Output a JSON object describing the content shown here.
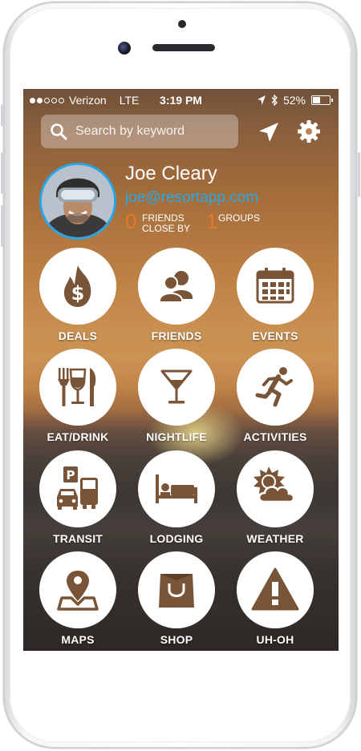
{
  "status_bar": {
    "carrier": "Verizon",
    "network": "LTE",
    "time": "3:19 PM",
    "battery": "52%",
    "battery_level": 0.52,
    "signal_bars": 2,
    "signal_total": 5
  },
  "search": {
    "placeholder": "Search by keyword"
  },
  "header_icons": {
    "location": "location-arrow-icon",
    "settings": "gear-icon"
  },
  "profile": {
    "name": "Joe Cleary",
    "email": "joe@resortapp.com",
    "friends_count": "0",
    "friends_label_1": "FRIENDS",
    "friends_label_2": "CLOSE BY",
    "groups_count": "1",
    "groups_label": "GROUPS"
  },
  "menu": [
    {
      "label": "DEALS",
      "icon": "dollar-fire-icon"
    },
    {
      "label": "FRIENDS",
      "icon": "friends-icon"
    },
    {
      "label": "EVENTS",
      "icon": "calendar-icon"
    },
    {
      "label": "EAT/DRINK",
      "icon": "fork-glass-knife-icon"
    },
    {
      "label": "NIGHTLIFE",
      "icon": "martini-icon"
    },
    {
      "label": "ACTIVITIES",
      "icon": "running-icon"
    },
    {
      "label": "TRANSIT",
      "icon": "transit-icon"
    },
    {
      "label": "LODGING",
      "icon": "bed-icon"
    },
    {
      "label": "WEATHER",
      "icon": "sun-cloud-icon"
    },
    {
      "label": "MAPS",
      "icon": "map-pin-icon"
    },
    {
      "label": "SHOP",
      "icon": "shopping-bag-icon"
    },
    {
      "label": "UH-OH",
      "icon": "warning-icon"
    }
  ],
  "colors": {
    "icon_brown": "#7a5436",
    "accent_blue": "#29a7e6",
    "accent_orange": "#e67a22"
  }
}
